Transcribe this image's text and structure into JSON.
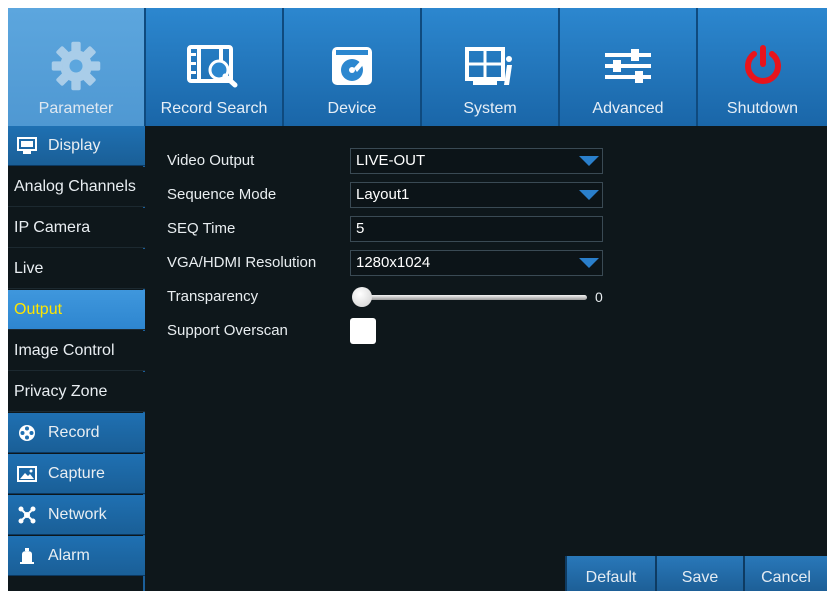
{
  "top_menu": [
    {
      "label": "Parameter",
      "icon": "gear-icon",
      "active": true
    },
    {
      "label": "Record Search",
      "icon": "film-search-icon",
      "active": false
    },
    {
      "label": "Device",
      "icon": "hdd-icon",
      "active": false
    },
    {
      "label": "System",
      "icon": "system-info-icon",
      "active": false
    },
    {
      "label": "Advanced",
      "icon": "sliders-icon",
      "active": false
    },
    {
      "label": "Shutdown",
      "icon": "power-icon",
      "active": false
    }
  ],
  "sidebar": {
    "display": "Display",
    "analog_channels": "Analog Channels",
    "ip_camera": "IP Camera",
    "live": "Live",
    "output": "Output",
    "image_control": "Image Control",
    "privacy_zone": "Privacy Zone",
    "record": "Record",
    "capture": "Capture",
    "network": "Network",
    "alarm": "Alarm"
  },
  "form": {
    "video_output_label": "Video Output",
    "video_output_value": "LIVE-OUT",
    "sequence_mode_label": "Sequence Mode",
    "sequence_mode_value": "Layout1",
    "seq_time_label": "SEQ Time",
    "seq_time_value": "5",
    "resolution_label": "VGA/HDMI Resolution",
    "resolution_value": "1280x1024",
    "transparency_label": "Transparency",
    "transparency_value": "0",
    "support_overscan_label": "Support Overscan"
  },
  "buttons": {
    "default": "Default",
    "save": "Save",
    "cancel": "Cancel"
  },
  "colors": {
    "accent": "#2f86cf",
    "selected_text": "#ffe600",
    "power_red": "#e8141c"
  }
}
